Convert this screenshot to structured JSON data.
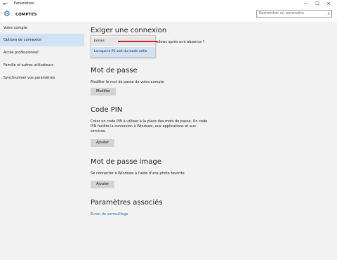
{
  "window": {
    "back_glyph": "←",
    "title": "Paramètres",
    "minimize": "—",
    "maximize": "☐",
    "close": "✕"
  },
  "header": {
    "gear_glyph": "⚙",
    "section": "COMPTES"
  },
  "search": {
    "placeholder": "Rechercher un paramètre",
    "icon_glyph": "⌕"
  },
  "sidebar": {
    "items": [
      {
        "label": "Votre compte"
      },
      {
        "label": "Options de connexion"
      },
      {
        "label": "Accès professionnel"
      },
      {
        "label": "Famille et autres utilisateurs"
      },
      {
        "label": "Synchroniser vos paramètres"
      }
    ]
  },
  "require": {
    "heading": "Exiger une connexion",
    "question_suffix": "ndows après une absence ?",
    "options": [
      "Jamais",
      "Lorsque le PC sort du mode veille"
    ]
  },
  "password": {
    "heading": "Mot de passe",
    "text": "Modifier le mot de passe de votre compte",
    "button": "Modifier"
  },
  "pin": {
    "heading": "Code PIN",
    "text1": "Créer un code PIN à utiliser à la place des mots de passe. Un code",
    "text2": "PIN facilite la connexion à Windows, aux applications et aux",
    "text3": "services.",
    "button": "Ajouter"
  },
  "picture": {
    "heading": "Mot de passe image",
    "text": "Se connecter à Windows à l'aide d'une photo favorite",
    "button": "Ajouter"
  },
  "related": {
    "heading": "Paramètres associés",
    "link": "Écran de verrouillage"
  },
  "colors": {
    "accent": "#1f6fb2",
    "annotation": "#d21f1f"
  }
}
